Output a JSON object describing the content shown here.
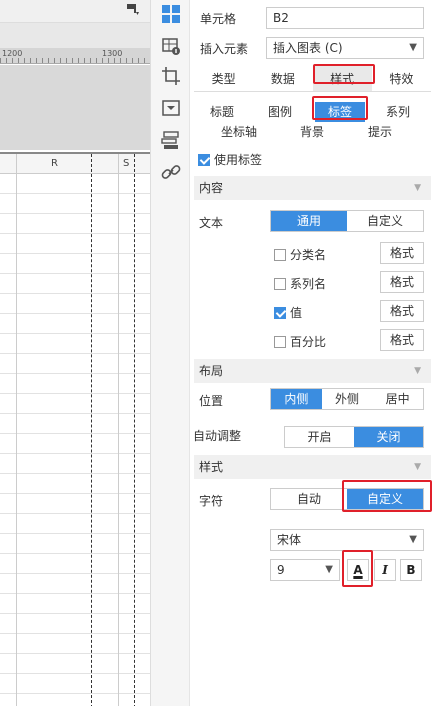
{
  "sheet": {
    "ruler_marks": [
      "1200",
      "1300"
    ],
    "column_headers": [
      "R",
      "S"
    ]
  },
  "icons": [
    "cell-icon",
    "cell-element-icon",
    "cell-attribute-icon",
    "widget-icon",
    "condition-icon",
    "hyperlink-icon"
  ],
  "panel": {
    "cell_label": "单元格",
    "cell_value": "B2",
    "insert_label": "插入元素",
    "insert_value": "插入图表 (C)",
    "tabs": [
      "类型",
      "数据",
      "样式",
      "特效"
    ],
    "active_tab": "样式",
    "subtabs_row1": [
      "标题",
      "图例",
      "标签",
      "系列"
    ],
    "subtabs_row2": [
      "坐标轴",
      "背景",
      "提示"
    ],
    "active_subtab": "标签",
    "use_label": "使用标签",
    "use_label_checked": true,
    "content_section": "内容",
    "text_label": "文本",
    "text_options": [
      "通用",
      "自定义"
    ],
    "text_selected": "通用",
    "items": [
      {
        "label": "分类名",
        "checked": false,
        "button": "格式"
      },
      {
        "label": "系列名",
        "checked": false,
        "button": "格式"
      },
      {
        "label": "值",
        "checked": true,
        "button": "格式"
      },
      {
        "label": "百分比",
        "checked": false,
        "button": "格式"
      }
    ],
    "layout_section": "布局",
    "position_label": "位置",
    "position_options": [
      "内侧",
      "外侧",
      "居中"
    ],
    "position_selected": "内侧",
    "auto_label": "自动调整",
    "auto_options": [
      "开启",
      "关闭"
    ],
    "auto_selected": "关闭",
    "style_section": "样式",
    "char_label": "字符",
    "char_options": [
      "自动",
      "自定义"
    ],
    "char_selected": "自定义",
    "font_family": "宋体",
    "font_size": "9",
    "font_color_glyph": "A",
    "italic_glyph": "I",
    "bold_glyph": "B"
  },
  "colors": {
    "accent": "#3b8de0",
    "highlight": "#e0202a"
  }
}
